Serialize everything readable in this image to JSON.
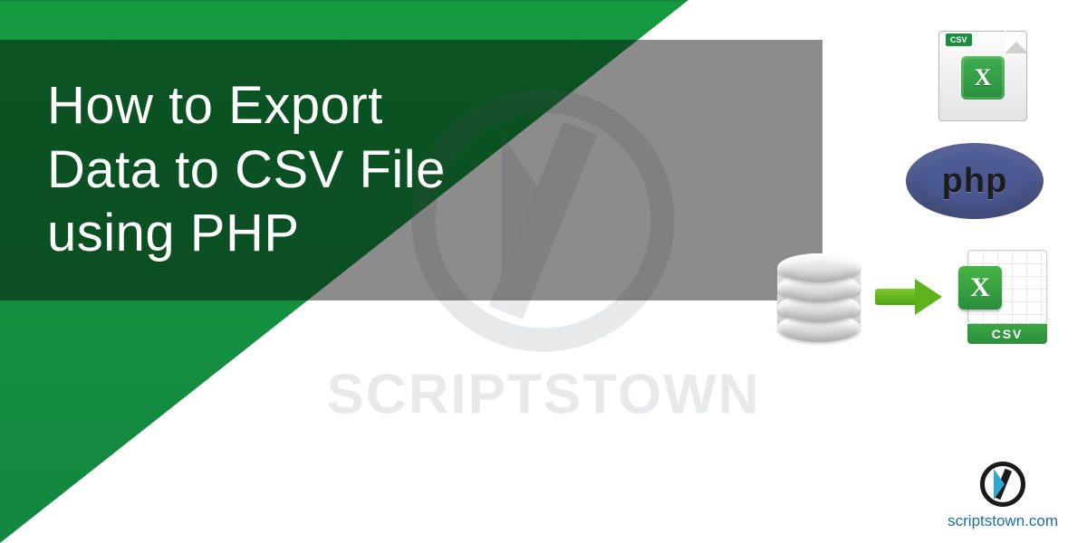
{
  "title": {
    "line1": "How to Export",
    "line2": "Data to CSV File",
    "line3": "using PHP"
  },
  "watermark": {
    "text": "SCRIPTSTOWN"
  },
  "icons": {
    "csv_file_tab": "CSV",
    "excel_letter": "X",
    "php_label": "php",
    "csv_band": "CSV",
    "x_badge": "X"
  },
  "brand": {
    "url": "scriptstown.com"
  }
}
